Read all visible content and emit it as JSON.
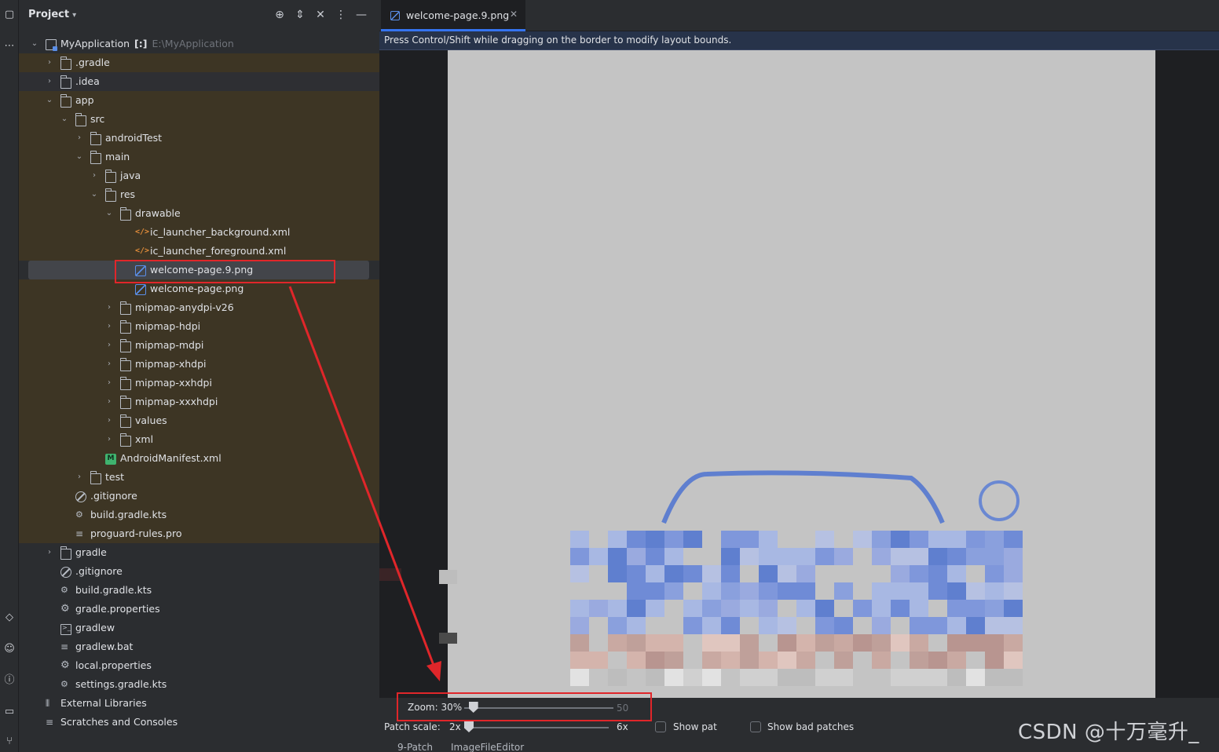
{
  "panel": {
    "title": "Project",
    "header_icons": [
      "crosshair-icon",
      "expand-collapse-icon",
      "collapse-all-icon",
      "more-icon",
      "minimize-icon"
    ]
  },
  "tree": [
    {
      "label": "MyApplication",
      "marker": "[:]",
      "path": "E:\\MyApplication",
      "type": "project",
      "expanded": true,
      "level": 0
    },
    {
      "label": ".gradle",
      "type": "folder",
      "expanded": false,
      "level": 1
    },
    {
      "label": ".idea",
      "type": "folder",
      "expanded": false,
      "level": 1
    },
    {
      "label": "app",
      "type": "folder",
      "expanded": true,
      "level": 1
    },
    {
      "label": "src",
      "type": "folder",
      "expanded": true,
      "level": 2
    },
    {
      "label": "androidTest",
      "type": "folder",
      "expanded": false,
      "level": 3
    },
    {
      "label": "main",
      "type": "folder",
      "expanded": true,
      "level": 3
    },
    {
      "label": "java",
      "type": "folder",
      "expanded": false,
      "level": 4
    },
    {
      "label": "res",
      "type": "folder",
      "expanded": true,
      "level": 4
    },
    {
      "label": "drawable",
      "type": "folder",
      "expanded": true,
      "level": 5
    },
    {
      "label": "ic_launcher_background.xml",
      "type": "xml",
      "level": 6
    },
    {
      "label": "ic_launcher_foreground.xml",
      "type": "xml",
      "level": 6
    },
    {
      "label": "welcome-page.9.png",
      "type": "png",
      "level": 6,
      "selected": true
    },
    {
      "label": "welcome-page.png",
      "type": "png",
      "level": 6
    },
    {
      "label": "mipmap-anydpi-v26",
      "type": "folder",
      "expanded": false,
      "level": 5
    },
    {
      "label": "mipmap-hdpi",
      "type": "folder",
      "expanded": false,
      "level": 5
    },
    {
      "label": "mipmap-mdpi",
      "type": "folder",
      "expanded": false,
      "level": 5
    },
    {
      "label": "mipmap-xhdpi",
      "type": "folder",
      "expanded": false,
      "level": 5
    },
    {
      "label": "mipmap-xxhdpi",
      "type": "folder",
      "expanded": false,
      "level": 5
    },
    {
      "label": "mipmap-xxxhdpi",
      "type": "folder",
      "expanded": false,
      "level": 5
    },
    {
      "label": "values",
      "type": "folder",
      "expanded": false,
      "level": 5
    },
    {
      "label": "xml",
      "type": "folder",
      "expanded": false,
      "level": 5
    },
    {
      "label": "AndroidManifest.xml",
      "type": "manifest",
      "level": 4
    },
    {
      "label": "test",
      "type": "folder",
      "expanded": false,
      "level": 3
    },
    {
      "label": ".gitignore",
      "type": "gitignore",
      "level": 2
    },
    {
      "label": "build.gradle.kts",
      "type": "gradle",
      "level": 2
    },
    {
      "label": "proguard-rules.pro",
      "type": "text",
      "level": 2
    },
    {
      "label": "gradle",
      "type": "folder",
      "expanded": false,
      "level": 1
    },
    {
      "label": ".gitignore",
      "type": "gitignore",
      "level": 1
    },
    {
      "label": "build.gradle.kts",
      "type": "gradle",
      "level": 1
    },
    {
      "label": "gradle.properties",
      "type": "settings",
      "level": 1
    },
    {
      "label": "gradlew",
      "type": "terminal",
      "level": 1
    },
    {
      "label": "gradlew.bat",
      "type": "text",
      "level": 1
    },
    {
      "label": "local.properties",
      "type": "settings",
      "level": 1
    },
    {
      "label": "settings.gradle.kts",
      "type": "gradle",
      "level": 1
    },
    {
      "label": "External Libraries",
      "type": "library",
      "level": 0
    },
    {
      "label": "Scratches and Consoles",
      "type": "scratch",
      "level": 0
    }
  ],
  "editor": {
    "tab_label": "welcome-page.9.png",
    "hint": "Press Control/Shift while dragging on the border to modify layout bounds."
  },
  "controls": {
    "zoom_label": "Zoom: 30%",
    "zoom_value": 30,
    "patch_scale_label": "Patch scale:",
    "patch_min": "2x",
    "patch_max": "6x",
    "zoom_max_partial": "50",
    "show_patches_label": "Show pat",
    "show_bad_patches_label": "Show bad patches",
    "bottom_tabs": [
      "9-Patch",
      "ImageFileEditor"
    ]
  },
  "watermark": "CSDN @十万毫升_",
  "colors": {
    "accent": "#3574f0",
    "annotation": "#e0262a",
    "tan_row": "#3d3524"
  }
}
